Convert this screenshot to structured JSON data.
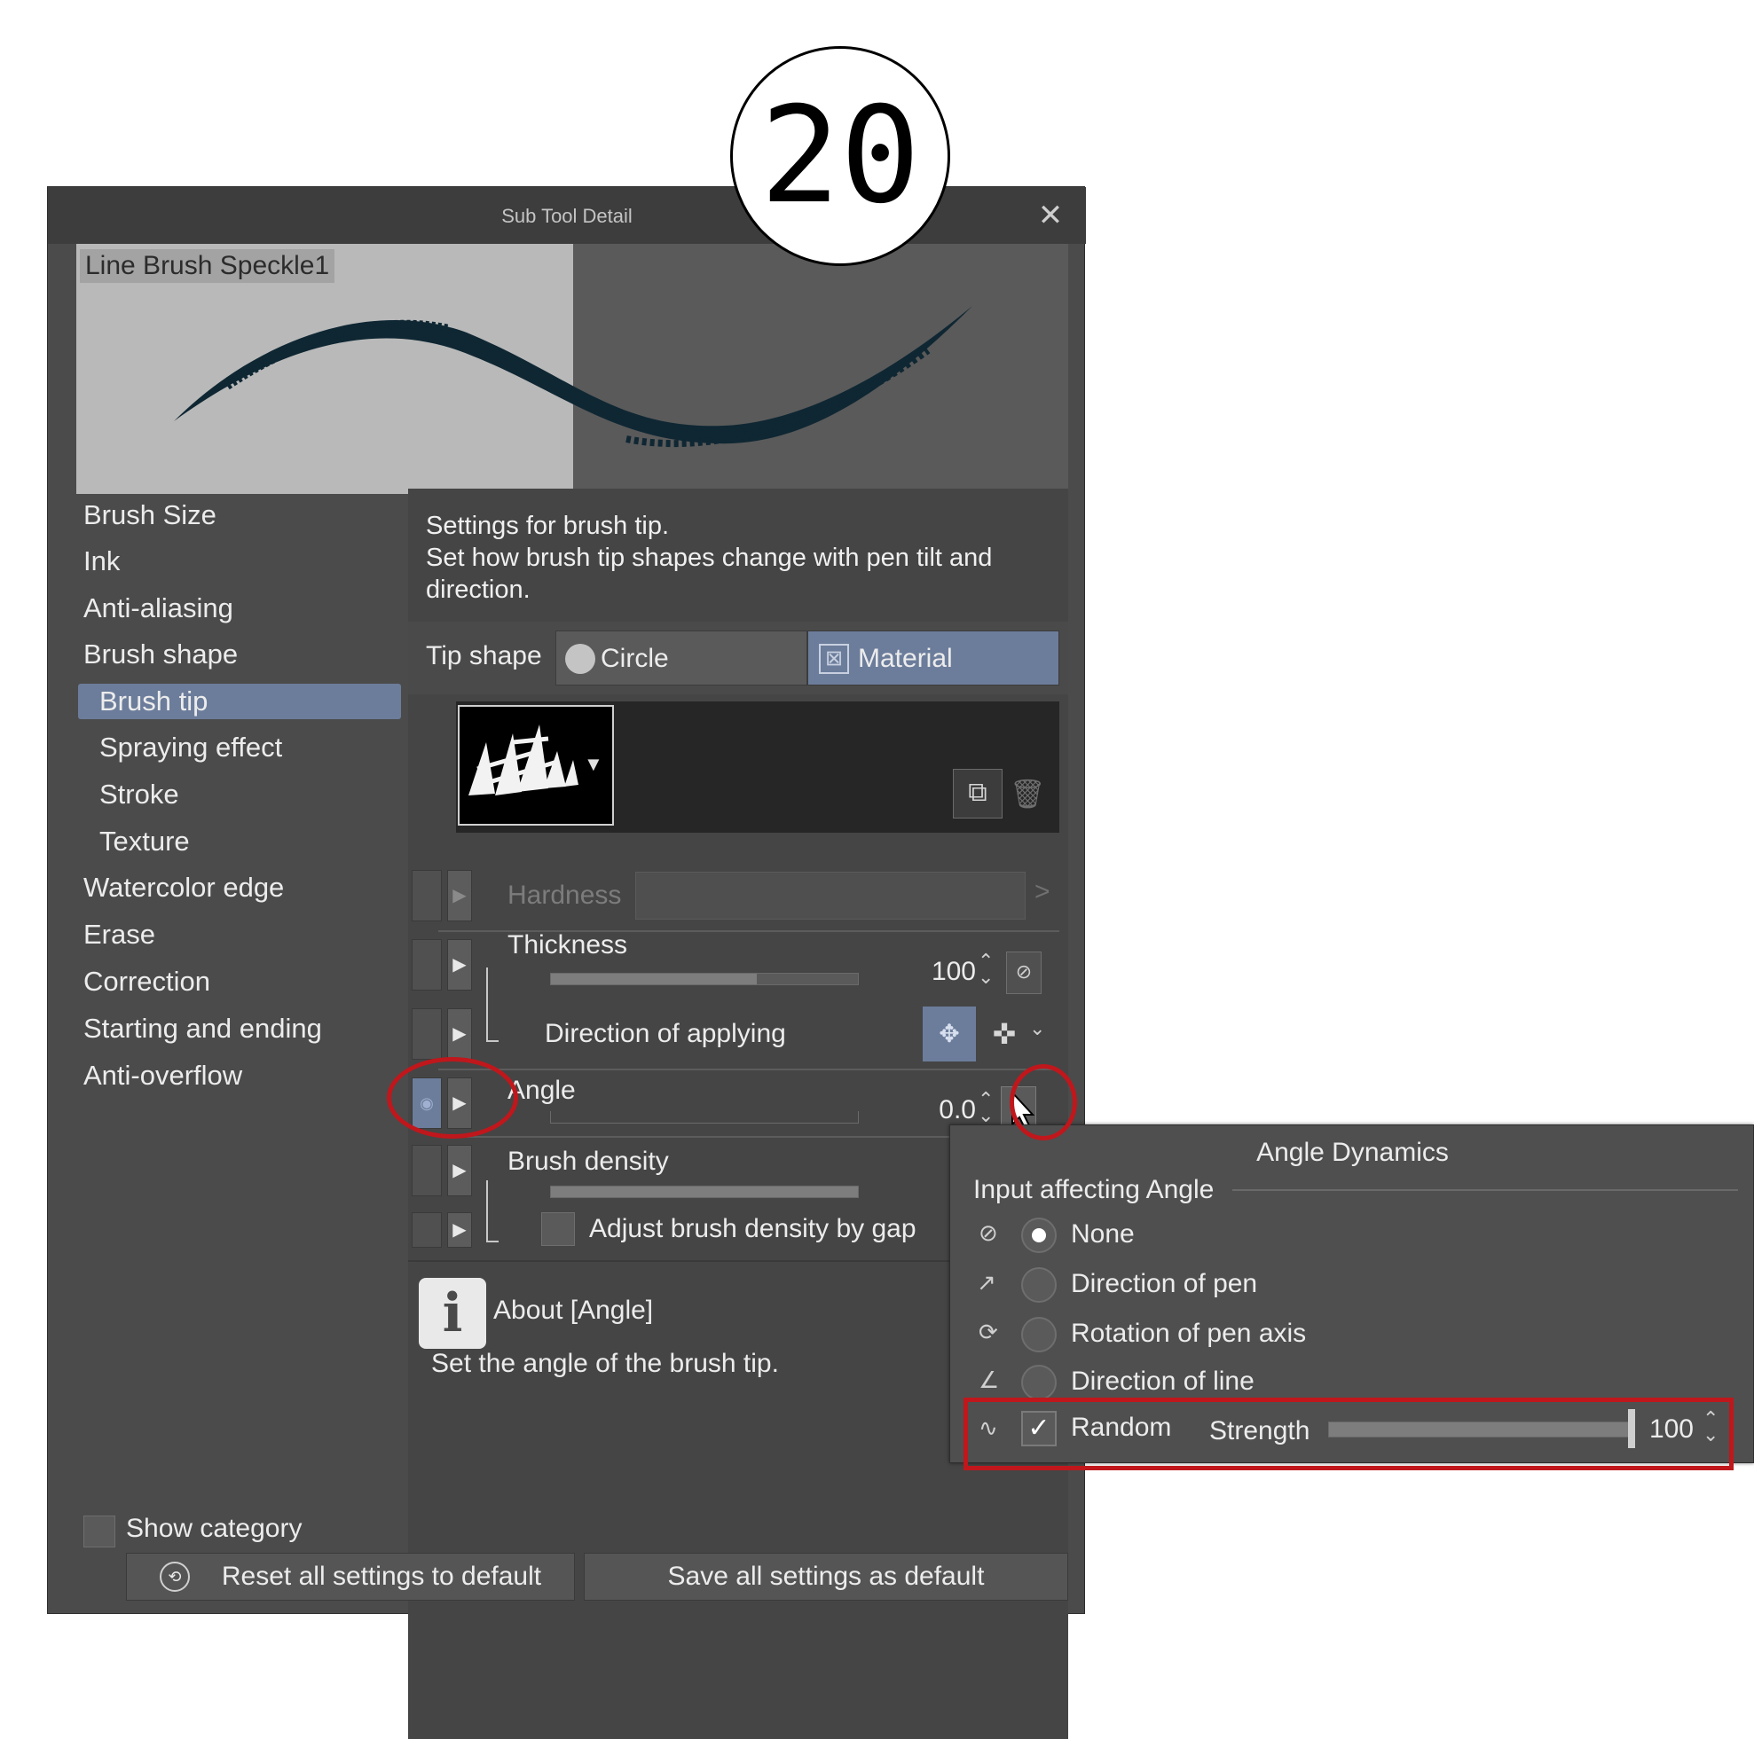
{
  "step_number": "20",
  "dialog": {
    "title": "Sub Tool Detail",
    "close_symbol": "✕",
    "preview_name": "Line Brush Speckle1"
  },
  "categories": [
    {
      "label": "Brush Size",
      "sub": false,
      "active": false
    },
    {
      "label": "Ink",
      "sub": false,
      "active": false
    },
    {
      "label": "Anti-aliasing",
      "sub": false,
      "active": false
    },
    {
      "label": "Brush shape",
      "sub": false,
      "active": false
    },
    {
      "label": "Brush tip",
      "sub": true,
      "active": true
    },
    {
      "label": "Spraying effect",
      "sub": true,
      "active": false
    },
    {
      "label": "Stroke",
      "sub": true,
      "active": false
    },
    {
      "label": "Texture",
      "sub": true,
      "active": false
    },
    {
      "label": "Watercolor edge",
      "sub": false,
      "active": false
    },
    {
      "label": "Erase",
      "sub": false,
      "active": false
    },
    {
      "label": "Correction",
      "sub": false,
      "active": false
    },
    {
      "label": "Starting and ending",
      "sub": false,
      "active": false
    },
    {
      "label": "Anti-overflow",
      "sub": false,
      "active": false
    }
  ],
  "description": {
    "line1": "Settings for brush tip.",
    "line2": "Set how brush tip shapes change with pen tilt and",
    "line3": "direction."
  },
  "tip_shape": {
    "label": "Tip shape",
    "option_circle": "Circle",
    "option_material": "Material",
    "selected": "Material"
  },
  "params": {
    "hardness_label": "Hardness",
    "thickness_label": "Thickness",
    "thickness_value": "100",
    "thickness_fill": 0.67,
    "direction_label": "Direction of applying",
    "angle_label": "Angle",
    "angle_value": "0.0",
    "brush_density_label": "Brush density",
    "brush_density_fill": 1.0,
    "adjust_density_label": "Adjust brush density by gap"
  },
  "about": {
    "icon_letter": "i",
    "title": "About [Angle]",
    "text": "Set the angle of the brush tip."
  },
  "show_category_label": "Show category",
  "buttons": {
    "reset": "Reset all settings to default",
    "save": "Save all settings as default"
  },
  "angle_dynamics": {
    "title": "Angle Dynamics",
    "group_label": "Input affecting Angle",
    "options": [
      {
        "label": "None",
        "selected": true
      },
      {
        "label": "Direction of pen",
        "selected": false
      },
      {
        "label": "Rotation of pen axis",
        "selected": false
      },
      {
        "label": "Direction of line",
        "selected": false
      }
    ],
    "random_label": "Random",
    "random_checked": true,
    "strength_label": "Strength",
    "strength_value": "100",
    "strength_fill": 1.0
  },
  "colors": {
    "highlight_red": "#c0171c",
    "accent_blue": "#6c7d9b",
    "green_strip": "#1fa51f"
  }
}
